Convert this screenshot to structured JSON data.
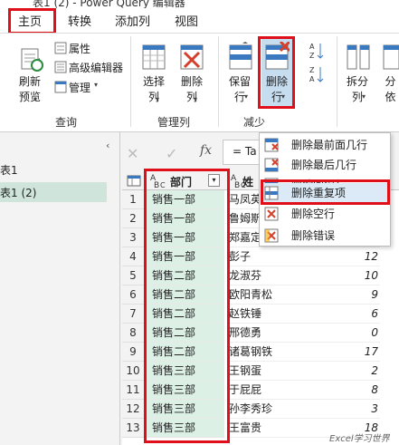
{
  "title": "表1 (2) - Power Query 编辑器",
  "tabs": [
    {
      "label": "主页"
    },
    {
      "label": "转换"
    },
    {
      "label": "添加列"
    },
    {
      "label": "视图"
    }
  ],
  "ribbon": {
    "refresh": {
      "line1": "刷新",
      "line2": "预览"
    },
    "properties": "属性",
    "advanced_editor": "高级编辑器",
    "manage": "管理",
    "choose_cols": {
      "line1": "选择",
      "line2": "列"
    },
    "remove_cols": {
      "line1": "删除",
      "line2": "列"
    },
    "keep_rows": {
      "line1": "保留",
      "line2": "行"
    },
    "remove_rows": {
      "line1": "删除",
      "line2": "行"
    },
    "split": {
      "line1": "拆分",
      "line2": "列"
    },
    "group": {
      "line1": "分",
      "line2": "依"
    },
    "groups": {
      "query": "查询",
      "manage_cols": "管理列",
      "reduce": "减少"
    }
  },
  "left_pane": {
    "items": [
      {
        "label": "表1"
      },
      {
        "label": "表1 (2)"
      }
    ]
  },
  "formula": {
    "fx": "fx",
    "text": "= Ta"
  },
  "grid": {
    "col1_header": "部门",
    "col2_header": "姓",
    "rows": [
      {
        "n": "1",
        "dept": "销售一部",
        "name": "马凤英",
        "val": ""
      },
      {
        "n": "2",
        "dept": "销售一部",
        "name": "鲁姆斯",
        "val": ""
      },
      {
        "n": "3",
        "dept": "销售一部",
        "name": "郑嘉定",
        "val": ""
      },
      {
        "n": "4",
        "dept": "销售一部",
        "name": "彭子",
        "val": "12"
      },
      {
        "n": "5",
        "dept": "销售二部",
        "name": "龙淑芬",
        "val": "10"
      },
      {
        "n": "6",
        "dept": "销售二部",
        "name": "欧阳青松",
        "val": "9"
      },
      {
        "n": "7",
        "dept": "销售二部",
        "name": "赵铁锤",
        "val": "6"
      },
      {
        "n": "8",
        "dept": "销售二部",
        "name": "邢德勇",
        "val": "0"
      },
      {
        "n": "9",
        "dept": "销售二部",
        "name": "诸葛钢铁",
        "val": "17"
      },
      {
        "n": "10",
        "dept": "销售三部",
        "name": "王钢蛋",
        "val": "2"
      },
      {
        "n": "11",
        "dept": "销售三部",
        "name": "于屁屁",
        "val": "8"
      },
      {
        "n": "12",
        "dept": "销售三部",
        "name": "孙李秀珍",
        "val": "3"
      },
      {
        "n": "13",
        "dept": "销售三部",
        "name": "王富贵",
        "val": "18"
      }
    ]
  },
  "menu": {
    "items": [
      {
        "label": "删除最前面几行"
      },
      {
        "label": "删除最后几行"
      },
      {
        "label": "删除间隔行"
      },
      {
        "label": "删除重复项"
      },
      {
        "label": "删除空行"
      },
      {
        "label": "删除错误"
      }
    ]
  },
  "watermark": "Excel学习世界",
  "colors": {
    "highlight_red": "#e0101a",
    "dept_fill": "#dcf0e6",
    "selected_nav": "#cfe5db"
  }
}
